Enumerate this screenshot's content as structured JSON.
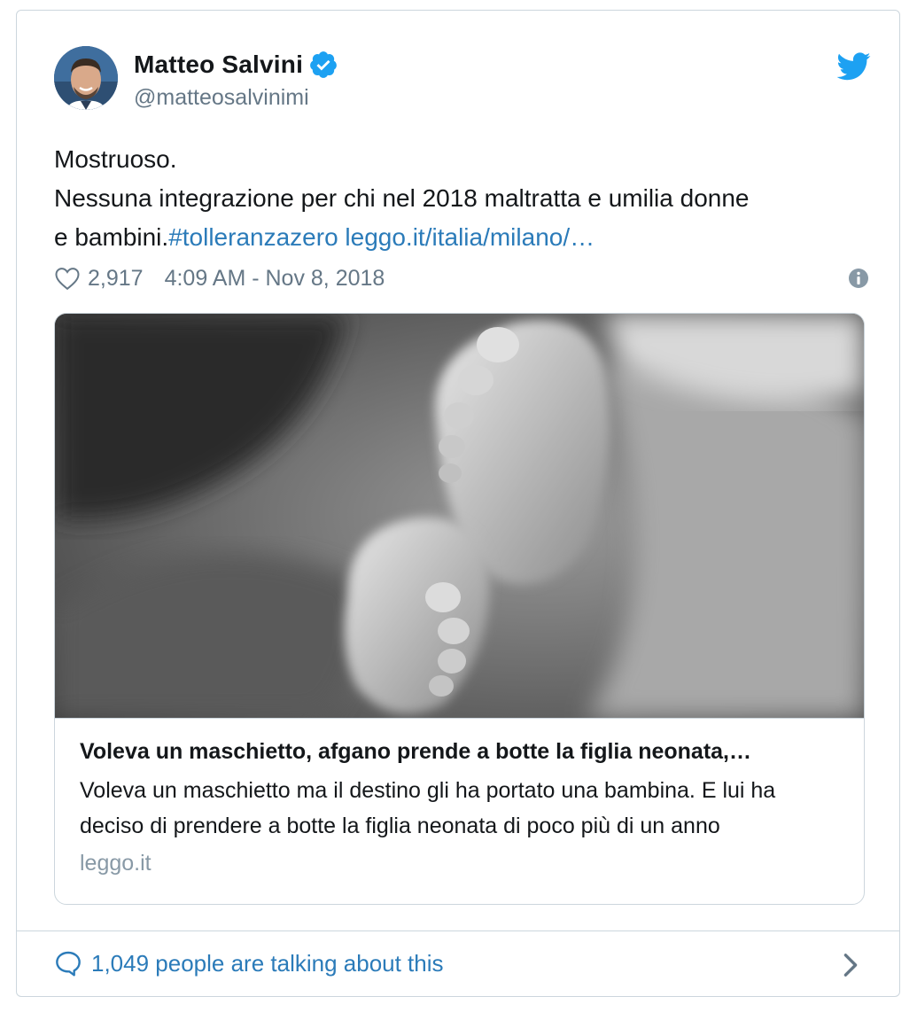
{
  "author": {
    "display_name": "Matteo Salvini",
    "handle": "@matteosalvinimi",
    "verified_icon": "verified-badge-icon"
  },
  "tweet": {
    "line1": "Mostruoso.",
    "line2": "Nessuna integrazione per chi nel 2018 maltratta e umilia donne",
    "line3_prefix": "e bambini.",
    "hashtag": "#tolleranzazero",
    "link": "leggo.it/italia/milano/…"
  },
  "meta": {
    "likes": "2,917",
    "timestamp": "4:09 AM - Nov 8, 2018"
  },
  "card": {
    "title": "Voleva un maschietto, afgano prende a botte la figlia neonata,…",
    "description": "Voleva un maschietto ma il destino gli ha portato una bambina. E lui ha deciso di prendere a botte la figlia neonata di poco più di un anno",
    "domain": "leggo.it"
  },
  "footer": {
    "talking": "1,049 people are talking about this"
  },
  "colors": {
    "link": "#2b7bb9",
    "twitter_blue": "#1da1f2",
    "text": "#14171a",
    "muted": "#657786",
    "border": "#ccd6dd"
  }
}
